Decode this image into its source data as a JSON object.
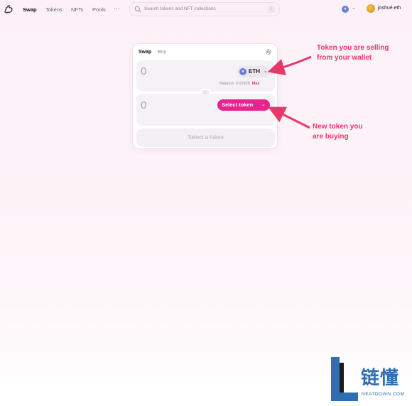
{
  "nav": {
    "links": [
      "Swap",
      "Tokens",
      "NFTs",
      "Pools"
    ],
    "more": "···",
    "search_placeholder": "Search tokens and NFT collections",
    "search_shortcut": "/",
    "chain_icon": "ethereum-icon",
    "account_name": "joshué.eth"
  },
  "card": {
    "tabs": [
      "Swap",
      "Buy"
    ],
    "sell": {
      "amount": "0",
      "token": "ETH",
      "balance_label": "Balance: 0.02928",
      "max_label": "Max"
    },
    "buy": {
      "amount": "0",
      "select_label": "Select token"
    },
    "cta_label": "Select a token"
  },
  "annotations": {
    "sell_note_line1": "Token you are selling",
    "sell_note_line2": "from your wallet",
    "buy_note_line1": "New token you",
    "buy_note_line2": "are buying",
    "color": "#e8386a"
  },
  "watermark": {
    "chinese": "链懂",
    "site": "NEATDOWN.COM",
    "color": "#2d6fb1"
  },
  "colors": {
    "accent": "#e6238e",
    "background": "#fdf1f7"
  }
}
